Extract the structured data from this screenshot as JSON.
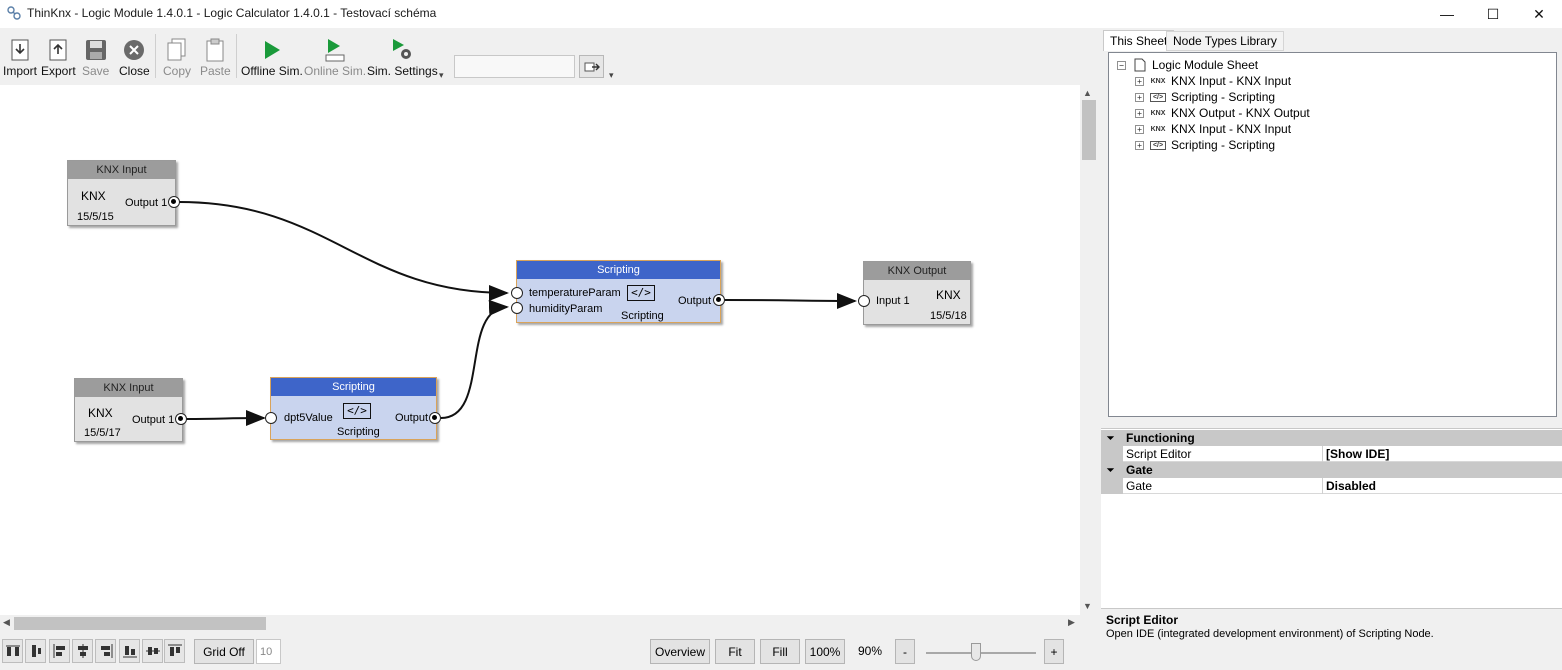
{
  "window": {
    "title": "ThinKnx - Logic Module 1.4.0.1 - Logic Calculator 1.4.0.1 - Testovací schéma",
    "minimize": "—",
    "maximize": "☐",
    "close": "✕"
  },
  "toolbar": {
    "import": "Import",
    "export": "Export",
    "save": "Save",
    "close": "Close",
    "copy": "Copy",
    "paste": "Paste",
    "offline_sim": "Offline Sim.",
    "online_sim": "Online Sim.",
    "sim_settings": "Sim. Settings",
    "sim_input_value": ""
  },
  "nodes": {
    "knx_in_1": {
      "header": "KNX Input",
      "label": "KNX",
      "port": "Output 1",
      "address": "15/5/15"
    },
    "knx_in_2": {
      "header": "KNX Input",
      "label": "KNX",
      "port": "Output 1",
      "address": "15/5/17"
    },
    "script_1": {
      "header": "Scripting",
      "in1": "temperatureParam",
      "in2": "humidityParam",
      "out": "Output",
      "footer": "Scripting",
      "icon": "</>"
    },
    "script_2": {
      "header": "Scripting",
      "in1": "dpt5Value",
      "out": "Output",
      "footer": "Scripting",
      "icon": "</>"
    },
    "knx_out": {
      "header": "KNX Output",
      "label": "KNX",
      "port": "Input 1",
      "address": "15/5/18"
    }
  },
  "bottombar": {
    "grid": "Grid Off",
    "grid_size": "10",
    "overview": "Overview",
    "fit": "Fit",
    "fill": "Fill",
    "hundred": "100%",
    "zoom": "90%",
    "zoom_out": "-",
    "zoom_in": "+",
    "zoom_fraction": 0.45
  },
  "tabs": {
    "this_sheet": "This Sheet",
    "library": "Node Types Library"
  },
  "tree": {
    "root": "Logic Module Sheet",
    "items": [
      {
        "icon": "KNX",
        "label": "KNX Input - KNX Input"
      },
      {
        "icon": "</>",
        "label": "Scripting - Scripting"
      },
      {
        "icon": "KNX",
        "label": "KNX Output - KNX Output"
      },
      {
        "icon": "KNX",
        "label": "KNX Input - KNX Input"
      },
      {
        "icon": "</>",
        "label": "Scripting - Scripting"
      }
    ]
  },
  "properties": {
    "functioning": "Functioning",
    "script_editor_name": "Script Editor",
    "script_editor_value": "[Show IDE]",
    "gate": "Gate",
    "gate_name": "Gate",
    "gate_value": "Disabled",
    "collapse": "⏷"
  },
  "description": {
    "title": "Script Editor",
    "text": "Open IDE (integrated development environment) of Scripting Node."
  },
  "colors": {
    "script_header": "#3e65c9",
    "script_body": "#c9d4ee",
    "knx_header": "#9c9c9c",
    "run_green": "#1a9a3a"
  }
}
